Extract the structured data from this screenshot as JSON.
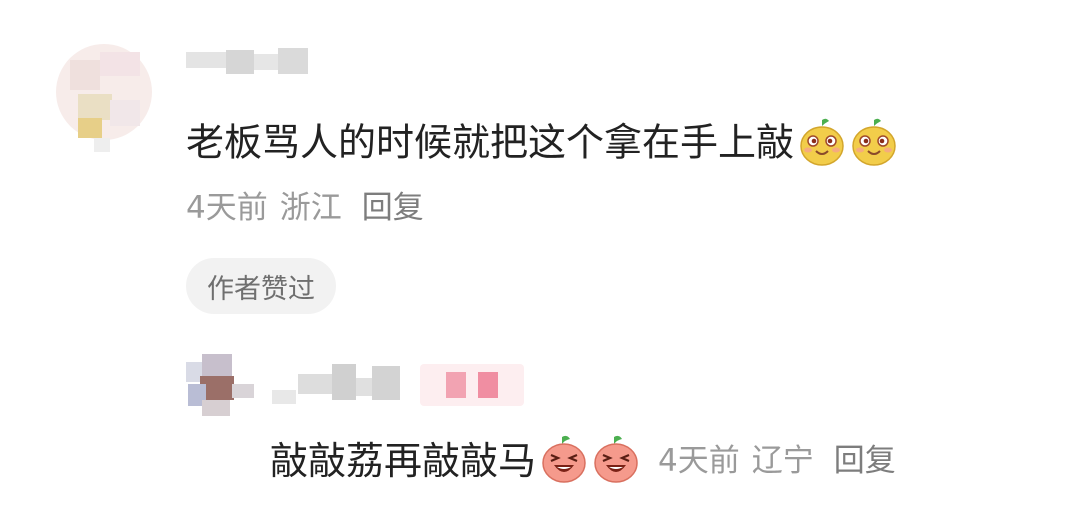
{
  "comment": {
    "text": "老板骂人的时候就把这个拿在手上敲",
    "emoji_icons": [
      "laughing-fruit-emoji-icon",
      "laughing-fruit-emoji-icon"
    ],
    "time": "4天前",
    "location": "浙江",
    "reply_label": "回复",
    "author_liked_badge": "作者赞过"
  },
  "reply": {
    "text": "敲敲荔再敲敲马",
    "emoji_icons": [
      "grinning-lychee-emoji-icon",
      "grinning-lychee-emoji-icon"
    ],
    "time": "4天前",
    "location": "辽宁",
    "reply_label": "回复"
  },
  "colors": {
    "text_primary": "#222222",
    "text_meta": "#9a9a9a",
    "badge_bg": "#f2f2f2",
    "emoji_yellow": "#f2cd4a",
    "emoji_pink": "#f59a8c"
  }
}
